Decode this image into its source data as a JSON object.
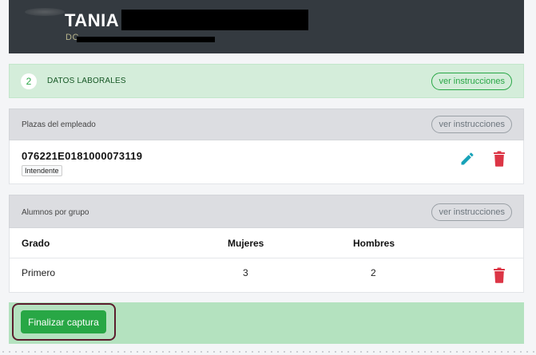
{
  "header": {
    "name": "TANIA",
    "subline": "DC"
  },
  "step": {
    "number": "2",
    "label": "DATOS LABORALES",
    "button": "ver instrucciones"
  },
  "plazas": {
    "title": "Plazas del empleado",
    "button": "ver instrucciones",
    "items": [
      {
        "code": "076221E0181000073119",
        "badge": "Intendente"
      }
    ]
  },
  "alumnos": {
    "title": "Alumnos por grupo",
    "button": "ver instrucciones",
    "columns": [
      "Grado",
      "Mujeres",
      "Hombres"
    ],
    "rows": [
      {
        "grado": "Primero",
        "mujeres": "3",
        "hombres": "2"
      }
    ]
  },
  "footer": {
    "finalize_label": "Finalizar captura"
  },
  "colors": {
    "header_bg": "#343a40",
    "success": "#28a745",
    "danger": "#dc3545",
    "info": "#17a2b8"
  },
  "icons": [
    "pencil-icon",
    "trash-icon"
  ]
}
